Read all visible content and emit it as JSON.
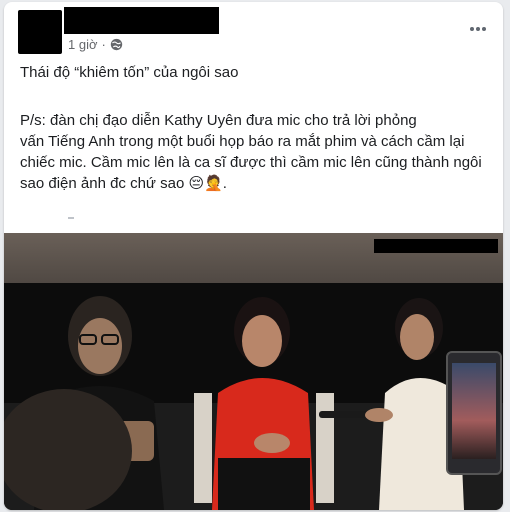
{
  "post": {
    "time": "1 giờ",
    "privacy_icon": "globe-icon",
    "more_icon": "more-options-icon",
    "headline": "Thái độ “khiêm tốn” của ngôi sao",
    "body_lines": [
      "P/s: đàn chị đạo diễn Kathy Uyên đưa mic cho trả lời phỏng",
      "vấn Tiếng Anh trong một buổi họp báo ra mắt phim và cách cầm lại",
      "chiếc mic. Cầm mic lên là ca sĩ được thì cầm mic lên cũng thành ngôi",
      "sao điện ảnh đc chứ sao 😔🤦."
    ]
  },
  "photo": {
    "description_icon": "press-conference-photo"
  }
}
